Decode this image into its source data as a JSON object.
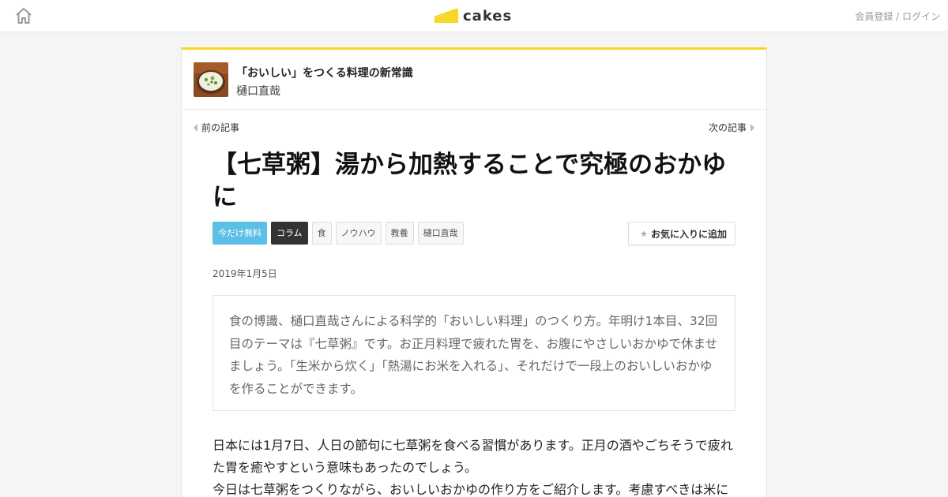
{
  "header": {
    "logo_text": "cakes",
    "auth_text": "会員登録 / ログイン",
    "accent_color": "#f7d826"
  },
  "series": {
    "title": "「おいしい」をつくる料理の新常識",
    "author": "樋口直哉"
  },
  "nav": {
    "prev_label": "前の記事",
    "next_label": "次の記事"
  },
  "article": {
    "title": "【七草粥】湯から加熱することで究極のおかゆに",
    "tags": [
      "今だけ無料",
      "コラム",
      "食",
      "ノウハウ",
      "教養",
      "樋口直哉"
    ],
    "favorite_label": "お気に入りに追加",
    "date": "2019年1月5日",
    "lead": "食の博識、樋口直哉さんによる科学的「おいしい料理」のつくり方。年明け1本目、32回目のテーマは『七草粥』です。お正月料理で疲れた胃を、お腹にやさしいおかゆで休ませましょう。「生米から炊く」「熱湯にお米を入れる」、それだけで一段上のおいしいおかゆを作ることができます。",
    "body": "日本には1月7日、人日の節句に七草粥を食べる習慣があります。正月の酒やごちそうで疲れた胃を癒やすという意味もあったのでしょう。\n今日は七草粥をつくりながら、おいしいおかゆの作り方をご紹介します。考慮すべきは米に"
  },
  "icons": {
    "home": "home-icon",
    "logo": "cheese-logo-icon",
    "prev": "chevron-left-icon",
    "next": "chevron-right-icon",
    "star": "star-icon"
  }
}
